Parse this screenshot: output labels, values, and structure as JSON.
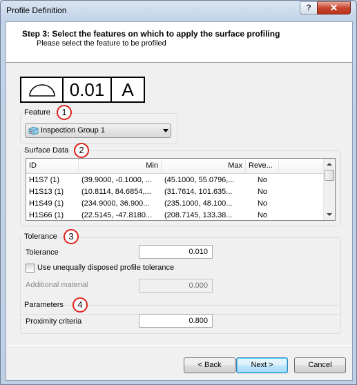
{
  "window": {
    "title": "Profile Definition",
    "help_label": "?",
    "close_label": "✕"
  },
  "header": {
    "step_title": "Step 3: Select the features on which to apply the surface profiling",
    "step_subtitle": "Please select the feature to be profiled"
  },
  "feature_control_frame": {
    "symbol": "surface-profile-icon",
    "tolerance": "0.01",
    "datum": "A"
  },
  "feature": {
    "label": "Feature",
    "badge": "1",
    "selected": "Inspection Group 1",
    "icon": "inspection-group-icon"
  },
  "surface_data": {
    "label": "Surface Data",
    "badge": "2",
    "columns": [
      "ID",
      "Min",
      "Max",
      "Reve..."
    ],
    "rows": [
      {
        "id": "H1S7 (1)",
        "min": "(39.9000, -0.1000, ...",
        "max": "(45.1000, 55.0796,...",
        "reverse": "No"
      },
      {
        "id": "H1S13 (1)",
        "min": "(10.8114, 84.6854,...",
        "max": "(31.7614, 101.635...",
        "reverse": "No"
      },
      {
        "id": "H1S49 (1)",
        "min": "(234.9000, 36.900...",
        "max": "(235.1000, 48.100...",
        "reverse": "No"
      },
      {
        "id": "H1S66 (1)",
        "min": "(22.5145, -47.8180...",
        "max": "(208.7145, 133.38...",
        "reverse": "No"
      }
    ]
  },
  "tolerance": {
    "group_label": "Tolerance",
    "badge": "3",
    "tolerance_label": "Tolerance",
    "tolerance_value": "0.010",
    "unequal_label": "Use unequally disposed profile tolerance",
    "unequal_checked": false,
    "additional_label": "Additional material",
    "additional_value": "0.000"
  },
  "parameters": {
    "group_label": "Parameters",
    "badge": "4",
    "proximity_label": "Proximity criteria",
    "proximity_value": "0.800"
  },
  "buttons": {
    "back": "< Back",
    "next": "Next >",
    "cancel": "Cancel"
  },
  "colors": {
    "badge_border": "#e0201a",
    "default_button": "#3c7fb1"
  }
}
